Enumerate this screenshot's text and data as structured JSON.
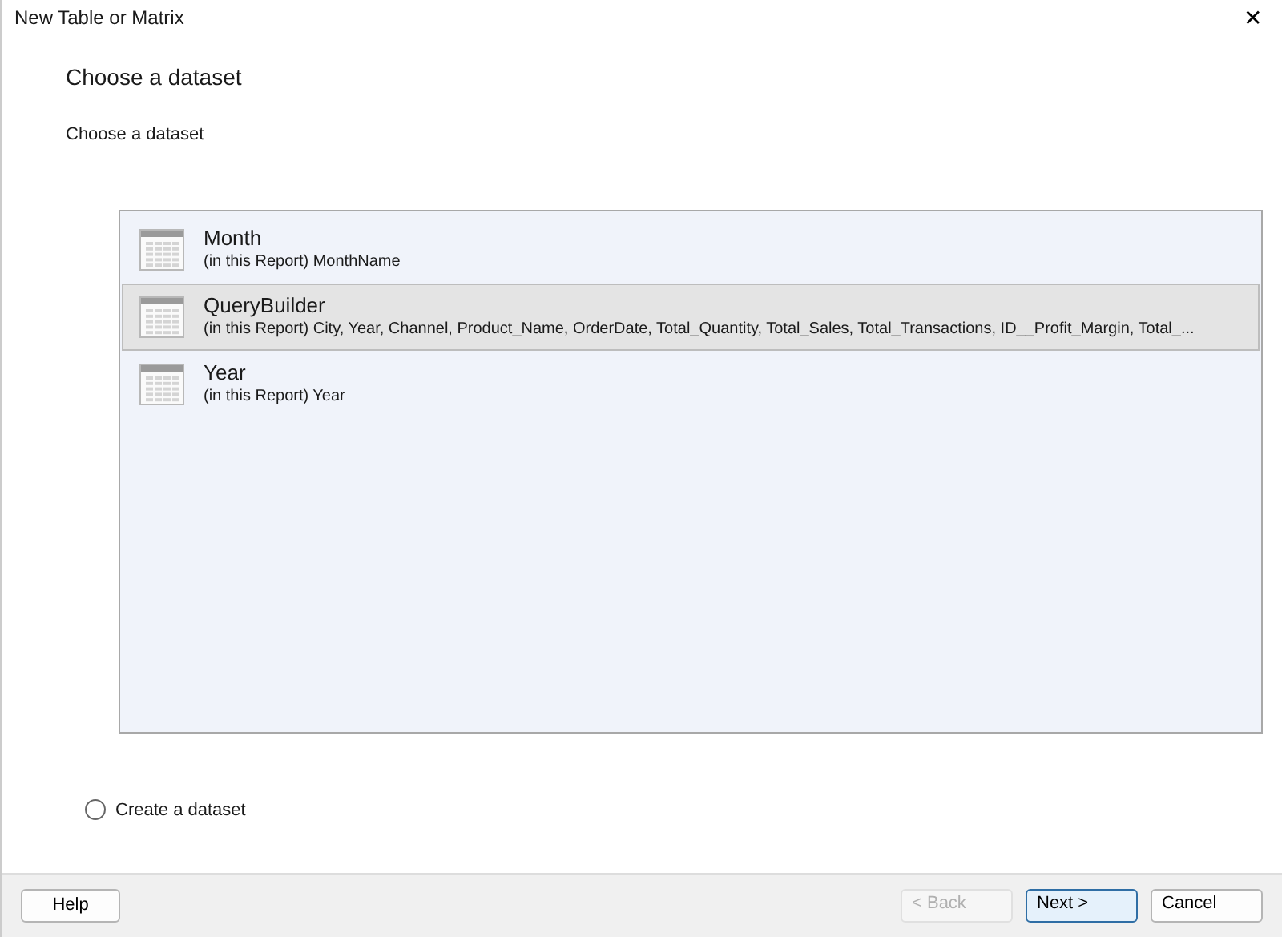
{
  "window": {
    "title": "New Table or Matrix",
    "close": "✕"
  },
  "page_title": "Choose a dataset",
  "section_label": "Choose a dataset",
  "datasets": [
    {
      "name": "Month",
      "fields": "(in this Report) MonthName",
      "selected": false
    },
    {
      "name": "QueryBuilder",
      "fields": "(in this Report) City, Year, Channel, Product_Name, OrderDate, Total_Quantity, Total_Sales, Total_Transactions, ID__Profit_Margin, Total_...",
      "selected": true
    },
    {
      "name": "Year",
      "fields": "(in this Report) Year",
      "selected": false
    }
  ],
  "create_option": {
    "label": "Create a dataset",
    "checked": false
  },
  "buttons": [
    {
      "label": "Help",
      "kind": "help",
      "disabled": false,
      "default": false
    },
    {
      "label": "< Back",
      "kind": "nav",
      "disabled": true,
      "default": false
    },
    {
      "label": "Next >",
      "kind": "nav",
      "disabled": false,
      "default": true
    },
    {
      "label": "Cancel",
      "kind": "nav",
      "disabled": false,
      "default": false
    }
  ]
}
